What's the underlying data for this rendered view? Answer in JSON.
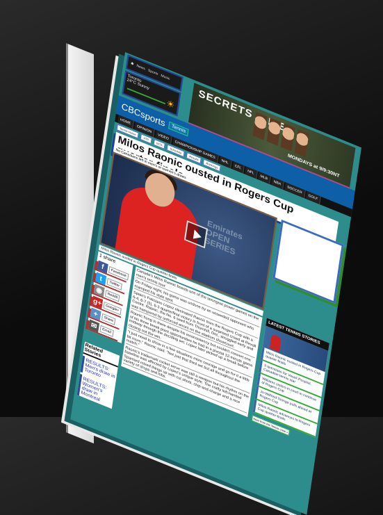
{
  "topbar": {
    "items": [
      "News",
      "Sports",
      "Music"
    ]
  },
  "weather": {
    "city": "Toronto",
    "condition": "24°C Sunny"
  },
  "ad": {
    "title": "SECRETS & LIES",
    "subtitle": "MONDAYS at 9/9:30NT"
  },
  "header": {
    "logo": "CBCsports",
    "section": "Tennis"
  },
  "nav": [
    "HOME",
    "OPINION",
    "VIDEO",
    "CHAMPIONSHIP GAMES",
    "NHL",
    "CFL",
    "NFL",
    "MLB",
    "NBA",
    "SOCCER",
    "GOLF"
  ],
  "tags": [
    "Tennis Home",
    "ATP",
    "WTA",
    "Schedule",
    "Results",
    "Rankings"
  ],
  "article": {
    "title": "Milos Raonic ousted in Rogers Cup quarter-finals",
    "byline": "No Canadians left in men's or women's draws",
    "video_caption": "Milos Raonic ousted in Rogers Cup quarter-finals",
    "paragraphs": [
      "Canada's Milos Raonic boasts one of the strongest power games on the men's tennis tour.",
      "On Friday night, his game was undone by an unseeded opponent who cramped his style spot.",
      "Spain's Feliciano Lopez eliminated Raonic from the Rogers Cup with a 6-4, 6-7 (5), 6-3 quarterfinal victory in front of a surprised crowd at Rexall Centre. Raonic, the No. 6 seed from Thornhill, Ont., struggled early and was hampered by unforced errors on the stadium showcourt.",
      "Raonic hung in there despite his inconsistency but couldn't convert one of his three break point opportunities he had in a pivotal 12-minute game midway through the deciding set. Lopez later picked up a break before closing out the win.",
      "\"I just need to show in a few situations more courage and go for it a little bit more,\" Raonic said. \"Not just that third set but all throughout the match.\"",
      "Raonic's trademark rocket serve was still a weapon but his rhythm on the baseline was affected by Lopez's unique style. The crafty left-handed Spaniard mixed things up with cut shots, chip-and-charge and a nice variety of drops and lobs."
    ]
  },
  "share": {
    "heading": "1 share",
    "buttons": [
      "Facebook",
      "Twitter",
      "Reddit",
      "Google+",
      "Share",
      "Email"
    ]
  },
  "related": {
    "heading": "Related Stories",
    "links": [
      "RESULTS: Men's draw in Toronto",
      "RESULTS: Women's draw in Montreal"
    ]
  },
  "latest": {
    "heading": "LATEST TENNIS STORIES",
    "items": [
      "Milos Raonic ousted in Rogers Cup quarter-finals",
      "3 questions for Vasek Pospisil, Canadian tennis star",
      "Williams sisters in court in continue of Rogers Cup",
      "Jo-Wilfried Tsonga pulls ahead at Rogers Cup",
      "Milos Raonic advances to Rogers Cup quarter-finals"
    ],
    "footer": "Hear from the Tennis crew »"
  }
}
